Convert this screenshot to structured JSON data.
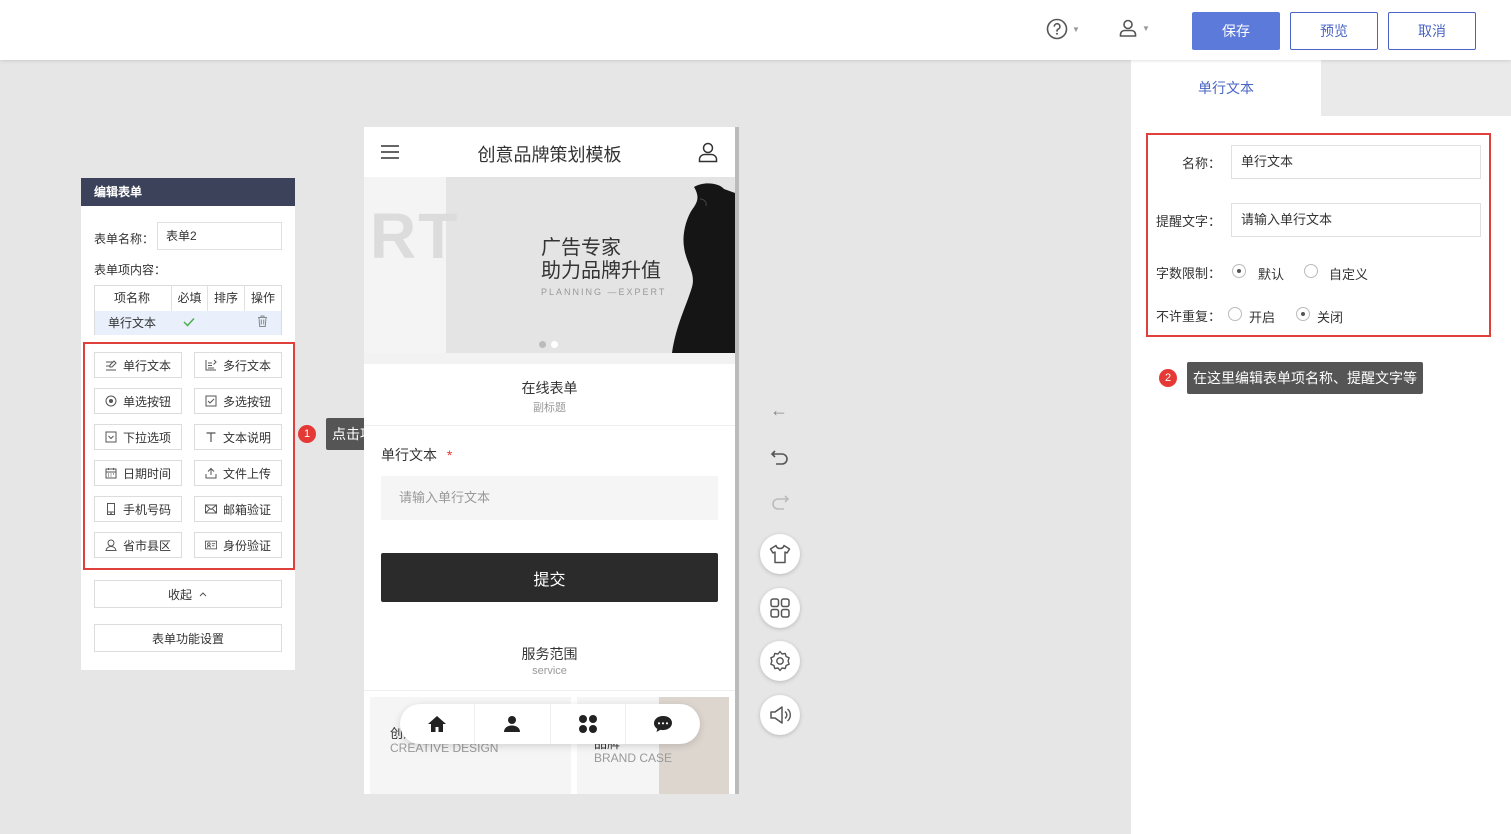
{
  "topbar": {
    "help_icon": "question-circle-icon",
    "user_icon": "user-icon",
    "save_label": "保存",
    "preview_label": "预览",
    "cancel_label": "取消"
  },
  "left_panel": {
    "title": "编辑表单",
    "form_name_label": "表单名称：",
    "form_name_value": "表单2",
    "items_label": "表单项内容：",
    "table_headers": [
      "项名称",
      "必填",
      "排序",
      "操作"
    ],
    "table_row": {
      "name": "单行文本"
    },
    "field_buttons": [
      {
        "label": "单行文本",
        "icon": "edit-line-icon"
      },
      {
        "label": "多行文本",
        "icon": "edit-lines-icon"
      },
      {
        "label": "单选按钮",
        "icon": "radio-icon"
      },
      {
        "label": "多选按钮",
        "icon": "checkbox-icon"
      },
      {
        "label": "下拉选项",
        "icon": "dropdown-icon"
      },
      {
        "label": "文本说明",
        "icon": "text-icon"
      },
      {
        "label": "日期时间",
        "icon": "calendar-icon"
      },
      {
        "label": "文件上传",
        "icon": "upload-icon"
      },
      {
        "label": "手机号码",
        "icon": "phone-icon"
      },
      {
        "label": "邮箱验证",
        "icon": "mail-icon"
      },
      {
        "label": "省市县区",
        "icon": "location-icon"
      },
      {
        "label": "身份验证",
        "icon": "id-card-icon"
      }
    ],
    "collapse_label": "收起",
    "settings_label": "表单功能设置"
  },
  "tooltips": {
    "tip1_badge": "1",
    "tip1_text": "点击项目名称即可添加表单项",
    "tip2_badge": "2",
    "tip2_text": "在这里编辑表单项名称、提醒文字等"
  },
  "phone": {
    "title": "创意品牌策划模板",
    "banner": {
      "big_letters": "RT",
      "headline1": "广告专家",
      "headline2": "助力品牌升值",
      "tagline": "PLANNING —EXPERT"
    },
    "form_section": {
      "title": "在线表单",
      "subtitle": "副标题",
      "field_label": "单行文本",
      "required_mark": "*",
      "field_placeholder": "请输入单行文本",
      "submit_label": "提交"
    },
    "service_section": {
      "title": "服务范围",
      "subtitle": "service",
      "card1_cn": "创意",
      "card1_en": "CREATIVE DESIGN",
      "card2_cn": "品牌",
      "card2_en": "BRAND CASE"
    }
  },
  "right_panel": {
    "tab_label": "单行文本",
    "name_label": "名称：",
    "name_value": "单行文本",
    "hint_label": "提醒文字：",
    "hint_value": "请输入单行文本",
    "limit_label": "字数限制：",
    "limit_options": [
      "默认",
      "自定义"
    ],
    "limit_selected": "默认",
    "repeat_label": "不许重复：",
    "repeat_options": [
      "开启",
      "关闭"
    ],
    "repeat_selected": "关闭"
  },
  "colors": {
    "accent": "#5b7ad9",
    "panel_header": "#3b4259",
    "highlight_red": "#e0403c",
    "submit_dark": "#2b2b2b"
  }
}
